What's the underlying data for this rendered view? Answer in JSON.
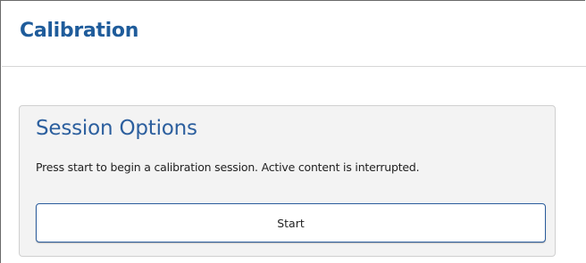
{
  "header": {
    "title": "Calibration"
  },
  "session_options": {
    "title": "Session Options",
    "description": "Press start to begin a calibration session. Active content is interrupted.",
    "start_label": "Start"
  },
  "colors": {
    "title_blue": "#1f5c9b",
    "panel_title_blue": "#2c5f9e",
    "button_border": "#2a5c9c",
    "panel_background": "#f3f3f3"
  }
}
